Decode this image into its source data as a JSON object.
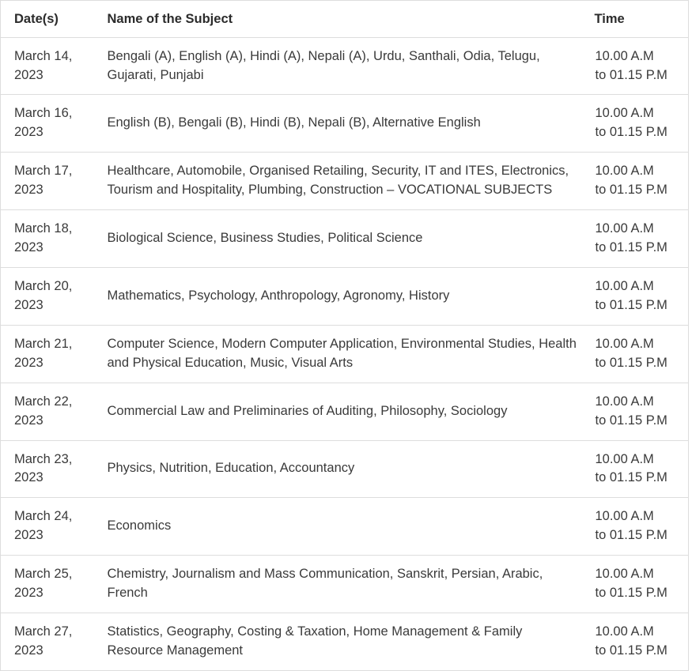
{
  "table": {
    "columns": [
      {
        "key": "date",
        "label": "Date(s)"
      },
      {
        "key": "subject",
        "label": "Name of the Subject"
      },
      {
        "key": "time",
        "label": "Time"
      }
    ],
    "rows": [
      {
        "date": "March 14, 2023",
        "subject": "Bengali (A), English (A), Hindi (A), Nepali (A), Urdu, Santhali, Odia, Telugu, Gujarati, Punjabi",
        "time": "10.00 A.M\nto 01.15 P.M"
      },
      {
        "date": "March 16, 2023",
        "subject": "English (B), Bengali (B), Hindi (B), Nepali (B), Alternative English",
        "time": "10.00 A.M\nto 01.15 P.M"
      },
      {
        "date": "March 17, 2023",
        "subject": "Healthcare, Automobile, Organised Retailing, Security, IT and ITES, Electronics, Tourism and Hospitality, Plumbing, Construction – VOCATIONAL SUBJECTS",
        "time": "10.00 A.M\nto 01.15 P.M"
      },
      {
        "date": "March 18, 2023",
        "subject": "Biological Science, Business Studies, Political Science",
        "time": "10.00 A.M\nto 01.15 P.M"
      },
      {
        "date": "March 20, 2023",
        "subject": "Mathematics, Psychology, Anthropology, Agronomy, History",
        "time": "10.00 A.M\nto 01.15 P.M"
      },
      {
        "date": "March 21, 2023",
        "subject": "Computer Science, Modern Computer Application, Environmental Studies, Health and Physical Education, Music, Visual Arts",
        "time": "10.00 A.M\nto 01.15 P.M"
      },
      {
        "date": "March 22, 2023",
        "subject": "Commercial Law and Preliminaries of Auditing, Philosophy, Sociology",
        "time": "10.00 A.M\nto 01.15 P.M"
      },
      {
        "date": "March 23, 2023",
        "subject": "Physics, Nutrition, Education, Accountancy",
        "time": "10.00 A.M\nto 01.15 P.M"
      },
      {
        "date": "March 24, 2023",
        "subject": "Economics",
        "time": "10.00 A.M\nto 01.15 P.M"
      },
      {
        "date": "March 25, 2023",
        "subject": "Chemistry, Journalism and Mass Communication, Sanskrit, Persian, Arabic, French",
        "time": "10.00 A.M\nto 01.15 P.M"
      },
      {
        "date": "March 27, 2023",
        "subject": "Statistics, Geography, Costing & Taxation, Home Management & Family Resource Management",
        "time": "10.00 A.M\nto 01.15 P.M"
      }
    ]
  },
  "colors": {
    "border": "#dddddd",
    "header_text": "#2b2b2b",
    "body_text": "#3a3a3a",
    "background": "#ffffff"
  }
}
